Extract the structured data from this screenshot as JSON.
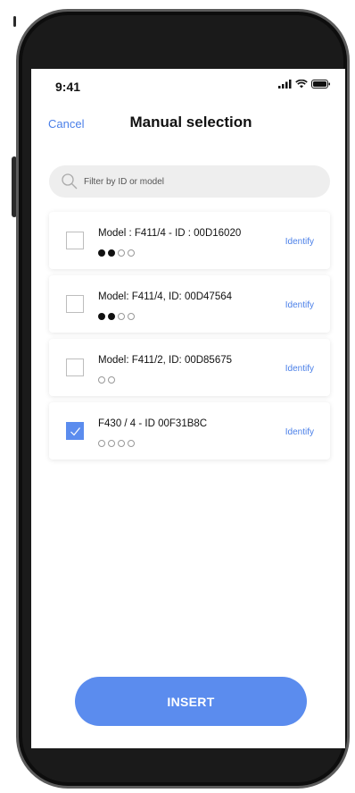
{
  "status": {
    "time": "9:41",
    "icons": [
      "signal-icon",
      "wifi-icon",
      "battery-icon"
    ]
  },
  "nav": {
    "cancel_label": "Cancel",
    "title": "Manual selection"
  },
  "search": {
    "placeholder": "Filter by ID or model"
  },
  "devices": [
    {
      "title": "Model : F411/4 - ID : 00D16020",
      "checked": false,
      "dots_filled": 2,
      "dots_total": 4,
      "identify_label": "Identify"
    },
    {
      "title": "Model: F411/4, ID: 00D47564",
      "checked": false,
      "dots_filled": 2,
      "dots_total": 4,
      "identify_label": "Identify"
    },
    {
      "title": "Model: F411/2, ID: 00D85675",
      "checked": false,
      "dots_filled": 0,
      "dots_total": 2,
      "identify_label": "Identify"
    },
    {
      "title": "F430 / 4 - ID 00F31B8C",
      "checked": true,
      "dots_filled": 0,
      "dots_total": 4,
      "identify_label": "Identify"
    }
  ],
  "insert_label": "INSERT",
  "colors": {
    "accent": "#4a7fe8",
    "button": "#5b8cee",
    "search_bg": "#eeeeee"
  }
}
